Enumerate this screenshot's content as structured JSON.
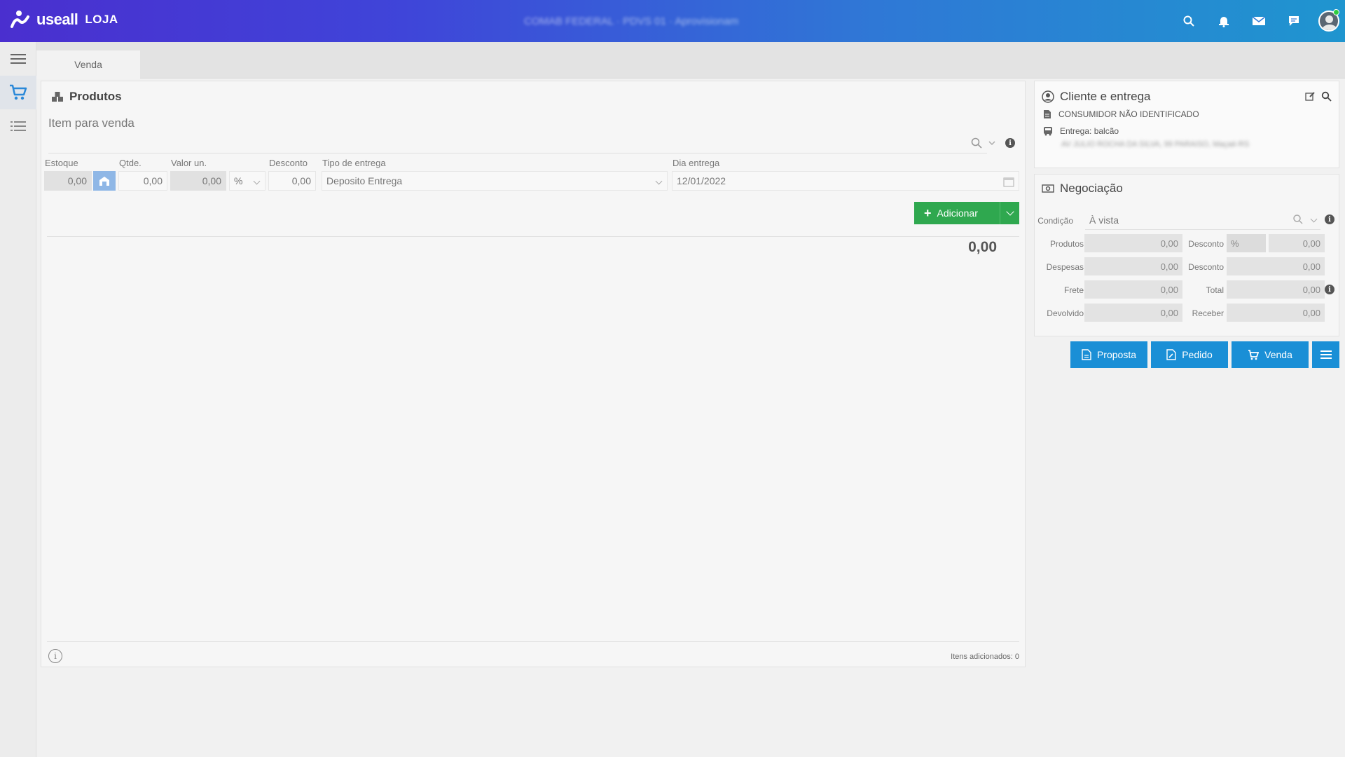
{
  "header": {
    "logo_text": "useall",
    "store_label": "LOJA",
    "center_text": "COMAB FEDERAL · PDVS 01 · Aprovisionam",
    "colors": {
      "gradient_start": "#4a2fcf",
      "gradient_end": "#1f95cf"
    },
    "icons": [
      "search-icon",
      "bell-icon",
      "mail-icon",
      "chat-icon"
    ]
  },
  "sidebar": {
    "items": [
      "menu-icon",
      "cart-icon",
      "list-icon"
    ]
  },
  "tabs": [
    {
      "label": "Venda"
    }
  ],
  "produtos": {
    "title": "Produtos",
    "item_label": "Item para venda",
    "item_value": "",
    "fields": {
      "estoque": {
        "label": "Estoque",
        "value": "0,00"
      },
      "qtde": {
        "label": "Qtde.",
        "value": "0,00"
      },
      "valor_un": {
        "label": "Valor un.",
        "value": "0,00",
        "unit": "%"
      },
      "desconto": {
        "label": "Desconto",
        "value": "0,00"
      },
      "tipo_entrega": {
        "label": "Tipo de entrega",
        "value": "Deposito Entrega"
      },
      "dia_entrega": {
        "label": "Dia entrega",
        "value": "12/01/2022"
      }
    },
    "add_button": "Adicionar",
    "total": "0,00",
    "items_added": "Itens adicionados: 0"
  },
  "cliente": {
    "title": "Cliente e entrega",
    "customer": "CONSUMIDOR NÃO IDENTIFICADO",
    "delivery": "Entrega: balcão",
    "address": "AV JULIO ROCHA DA SILVA, 99 PARAISO, Maçaé-RS"
  },
  "negociacao": {
    "title": "Negociação",
    "condicao_label": "Condição",
    "condicao_value": "À vista",
    "rows": [
      {
        "left_label": "Produtos",
        "left_value": "0,00",
        "right_label": "Desconto",
        "right_value": "0,00",
        "right_unit": "%"
      },
      {
        "left_label": "Despesas",
        "left_value": "0,00",
        "right_label": "Desconto",
        "right_value": "0,00"
      },
      {
        "left_label": "Frete",
        "left_value": "0,00",
        "right_label": "Total",
        "right_value": "0,00"
      },
      {
        "left_label": "Devolvido",
        "left_value": "0,00",
        "right_label": "Receber",
        "right_value": "0,00"
      }
    ]
  },
  "actions": {
    "proposta": "Proposta",
    "pedido": "Pedido",
    "venda": "Venda"
  }
}
